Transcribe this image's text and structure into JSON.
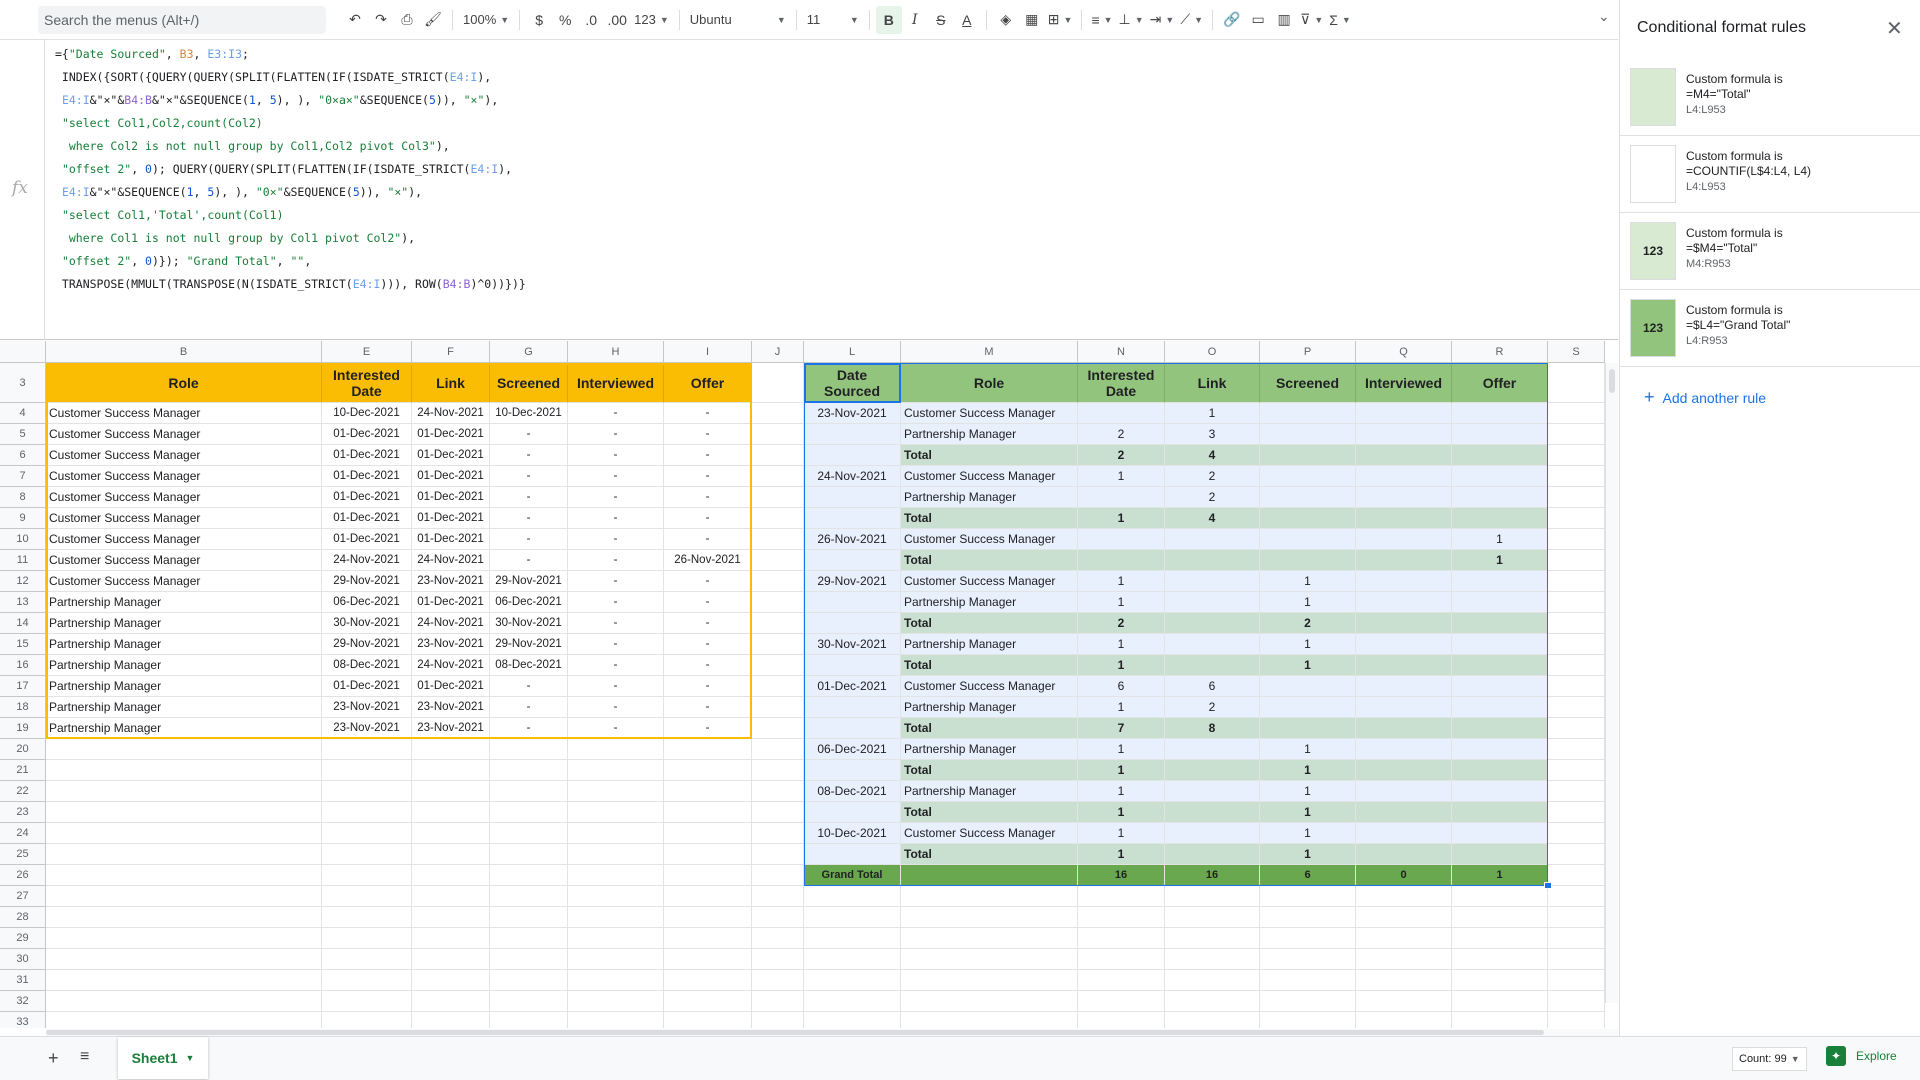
{
  "toolbar": {
    "search_placeholder": "Search the menus (Alt+/)",
    "zoom": "100%",
    "currency": "$",
    "percent": "%",
    "dec_less": ".0",
    "dec_more": ".00",
    "number_format": "123",
    "font": "Ubuntu",
    "font_size": "11",
    "bold": "B",
    "italic": "I",
    "strike": "S",
    "text_color": "A",
    "functions": "Σ"
  },
  "formula_bar": {
    "fx": "fx",
    "lines": [
      [
        [
          "={",
          "t"
        ],
        [
          "\"Date Sourced\"",
          "str"
        ],
        [
          ", ",
          "t"
        ],
        [
          "B3",
          "r1"
        ],
        [
          ", ",
          "t"
        ],
        [
          "E3:I3",
          "r2"
        ],
        [
          ";",
          "t"
        ]
      ],
      [
        [
          " INDEX({SORT({QUERY(QUERY(SPLIT(FLATTEN(IF(ISDATE_STRICT(",
          "t"
        ],
        [
          "E4:I",
          "r2"
        ],
        [
          "),",
          "t"
        ]
      ],
      [
        [
          " ",
          "t"
        ],
        [
          "E4:I",
          "r2"
        ],
        [
          "&\"×\"&",
          "t"
        ],
        [
          "B4:B",
          "r3"
        ],
        [
          "&\"×\"&SEQUENCE(",
          "t"
        ],
        [
          "1",
          "num"
        ],
        [
          ", ",
          "t"
        ],
        [
          "5",
          "num"
        ],
        [
          "), ), ",
          "t"
        ],
        [
          "\"0×a×\"",
          "str"
        ],
        [
          "&SEQUENCE(",
          "t"
        ],
        [
          "5",
          "num"
        ],
        [
          ")), ",
          "t"
        ],
        [
          "\"×\"",
          "str"
        ],
        [
          "),",
          "t"
        ]
      ],
      [
        [
          " ",
          "t"
        ],
        [
          "\"select Col1,Col2,count(Col2)",
          "str"
        ]
      ],
      [
        [
          "  ",
          "t"
        ],
        [
          "where Col2 is not null group by Col1,Col2 pivot Col3\"",
          "str"
        ],
        [
          "),",
          "t"
        ]
      ],
      [
        [
          " ",
          "t"
        ],
        [
          "\"offset 2\"",
          "str"
        ],
        [
          ", ",
          "t"
        ],
        [
          "0",
          "num"
        ],
        [
          "); QUERY(QUERY(SPLIT(FLATTEN(IF(ISDATE_STRICT(",
          "t"
        ],
        [
          "E4:I",
          "r2"
        ],
        [
          "),",
          "t"
        ]
      ],
      [
        [
          " ",
          "t"
        ],
        [
          "E4:I",
          "r2"
        ],
        [
          "&\"×\"&SEQUENCE(",
          "t"
        ],
        [
          "1",
          "num"
        ],
        [
          ", ",
          "t"
        ],
        [
          "5",
          "num"
        ],
        [
          "), ), ",
          "t"
        ],
        [
          "\"0×\"",
          "str"
        ],
        [
          "&SEQUENCE(",
          "t"
        ],
        [
          "5",
          "num"
        ],
        [
          ")), ",
          "t"
        ],
        [
          "\"×\"",
          "str"
        ],
        [
          "),",
          "t"
        ]
      ],
      [
        [
          " ",
          "t"
        ],
        [
          "\"select Col1,'Total',count(Col1)",
          "str"
        ]
      ],
      [
        [
          "  ",
          "t"
        ],
        [
          "where Col1 is not null group by Col1 pivot Col2\"",
          "str"
        ],
        [
          "),",
          "t"
        ]
      ],
      [
        [
          " ",
          "t"
        ],
        [
          "\"offset 2\"",
          "str"
        ],
        [
          ", ",
          "t"
        ],
        [
          "0",
          "num"
        ],
        [
          ")}); ",
          "t"
        ],
        [
          "\"Grand Total\"",
          "str"
        ],
        [
          ", ",
          "t"
        ],
        [
          "\"\"",
          "str"
        ],
        [
          ",",
          "t"
        ]
      ],
      [
        [
          " TRANSPOSE(MMULT(TRANSPOSE(N(ISDATE_STRICT(",
          "t"
        ],
        [
          "E4:I",
          "r2"
        ],
        [
          "))), ROW(",
          "t"
        ],
        [
          "B4:B",
          "r3"
        ],
        [
          ")^0))})}",
          "t"
        ]
      ]
    ]
  },
  "grid": {
    "col_headers": [
      "B",
      "E",
      "F",
      "G",
      "H",
      "I",
      "J",
      "L",
      "M",
      "N",
      "O",
      "P",
      "Q",
      "R",
      "S"
    ],
    "row_numbers": [
      "3",
      "4",
      "5",
      "6",
      "7",
      "8",
      "9",
      "10",
      "11",
      "12",
      "13",
      "14",
      "15",
      "16",
      "17",
      "18",
      "19",
      "20",
      "21",
      "22",
      "23",
      "24",
      "25",
      "26",
      "27",
      "28",
      "29",
      "30",
      "31",
      "32",
      "33"
    ],
    "left_table": {
      "headers": [
        "Role",
        "Interested Date",
        "Link",
        "Screened",
        "Interviewed",
        "Offer"
      ],
      "rows": [
        [
          "Customer Success Manager",
          "10-Dec-2021",
          "24-Nov-2021",
          "10-Dec-2021",
          "-",
          "-"
        ],
        [
          "Customer Success Manager",
          "01-Dec-2021",
          "01-Dec-2021",
          "-",
          "-",
          "-"
        ],
        [
          "Customer Success Manager",
          "01-Dec-2021",
          "01-Dec-2021",
          "-",
          "-",
          "-"
        ],
        [
          "Customer Success Manager",
          "01-Dec-2021",
          "01-Dec-2021",
          "-",
          "-",
          "-"
        ],
        [
          "Customer Success Manager",
          "01-Dec-2021",
          "01-Dec-2021",
          "-",
          "-",
          "-"
        ],
        [
          "Customer Success Manager",
          "01-Dec-2021",
          "01-Dec-2021",
          "-",
          "-",
          "-"
        ],
        [
          "Customer Success Manager",
          "01-Dec-2021",
          "01-Dec-2021",
          "-",
          "-",
          "-"
        ],
        [
          "Customer Success Manager",
          "24-Nov-2021",
          "24-Nov-2021",
          "-",
          "-",
          "26-Nov-2021"
        ],
        [
          "Customer Success Manager",
          "29-Nov-2021",
          "23-Nov-2021",
          "29-Nov-2021",
          "-",
          "-"
        ],
        [
          "Partnership Manager",
          "06-Dec-2021",
          "01-Dec-2021",
          "06-Dec-2021",
          "-",
          "-"
        ],
        [
          "Partnership Manager",
          "30-Nov-2021",
          "24-Nov-2021",
          "30-Nov-2021",
          "-",
          "-"
        ],
        [
          "Partnership Manager",
          "29-Nov-2021",
          "23-Nov-2021",
          "29-Nov-2021",
          "-",
          "-"
        ],
        [
          "Partnership Manager",
          "08-Dec-2021",
          "24-Nov-2021",
          "08-Dec-2021",
          "-",
          "-"
        ],
        [
          "Partnership Manager",
          "01-Dec-2021",
          "01-Dec-2021",
          "-",
          "-",
          "-"
        ],
        [
          "Partnership Manager",
          "23-Nov-2021",
          "23-Nov-2021",
          "-",
          "-",
          "-"
        ],
        [
          "Partnership Manager",
          "23-Nov-2021",
          "23-Nov-2021",
          "-",
          "-",
          "-"
        ]
      ]
    },
    "right_table": {
      "headers": [
        "Date Sourced",
        "Role",
        "Interested Date",
        "Link",
        "Screened",
        "Interviewed",
        "Offer"
      ],
      "rows": [
        [
          "23-Nov-2021",
          "Customer Success Manager",
          "",
          "1",
          "",
          "",
          ""
        ],
        [
          "",
          "Partnership Manager",
          "2",
          "3",
          "",
          "",
          ""
        ],
        [
          "",
          "Total",
          "2",
          "4",
          "",
          "",
          ""
        ],
        [
          "24-Nov-2021",
          "Customer Success Manager",
          "1",
          "2",
          "",
          "",
          ""
        ],
        [
          "",
          "Partnership Manager",
          "",
          "2",
          "",
          "",
          ""
        ],
        [
          "",
          "Total",
          "1",
          "4",
          "",
          "",
          ""
        ],
        [
          "26-Nov-2021",
          "Customer Success Manager",
          "",
          "",
          "",
          "",
          "1"
        ],
        [
          "",
          "Total",
          "",
          "",
          "",
          "",
          "1"
        ],
        [
          "29-Nov-2021",
          "Customer Success Manager",
          "1",
          "",
          "1",
          "",
          ""
        ],
        [
          "",
          "Partnership Manager",
          "1",
          "",
          "1",
          "",
          ""
        ],
        [
          "",
          "Total",
          "2",
          "",
          "2",
          "",
          ""
        ],
        [
          "30-Nov-2021",
          "Partnership Manager",
          "1",
          "",
          "1",
          "",
          ""
        ],
        [
          "",
          "Total",
          "1",
          "",
          "1",
          "",
          ""
        ],
        [
          "01-Dec-2021",
          "Customer Success Manager",
          "6",
          "6",
          "",
          "",
          ""
        ],
        [
          "",
          "Partnership Manager",
          "1",
          "2",
          "",
          "",
          ""
        ],
        [
          "",
          "Total",
          "7",
          "8",
          "",
          "",
          ""
        ],
        [
          "06-Dec-2021",
          "Partnership Manager",
          "1",
          "",
          "1",
          "",
          ""
        ],
        [
          "",
          "Total",
          "1",
          "",
          "1",
          "",
          ""
        ],
        [
          "08-Dec-2021",
          "Partnership Manager",
          "1",
          "",
          "1",
          "",
          ""
        ],
        [
          "",
          "Total",
          "1",
          "",
          "1",
          "",
          ""
        ],
        [
          "10-Dec-2021",
          "Customer Success Manager",
          "1",
          "",
          "1",
          "",
          ""
        ],
        [
          "",
          "Total",
          "1",
          "",
          "1",
          "",
          ""
        ],
        [
          "Grand Total",
          "",
          "16",
          "16",
          "6",
          "0",
          "1"
        ]
      ]
    }
  },
  "panel": {
    "title": "Conditional format rules",
    "rules": [
      {
        "type": "Custom formula is",
        "formula": "=M4=\"Total\"",
        "range": "L4:L953",
        "swatch": "",
        "color": "#d9ead3"
      },
      {
        "type": "Custom formula is",
        "formula": "=COUNTIF(L$4:L4, L4)",
        "range": "L4:L953",
        "swatch": "",
        "color": "#ffffff"
      },
      {
        "type": "Custom formula is",
        "formula": "=$M4=\"Total\"",
        "range": "M4:R953",
        "swatch": "123",
        "color": "#d9ead3"
      },
      {
        "type": "Custom formula is",
        "formula": "=$L4=\"Grand Total\"",
        "range": "L4:R953",
        "swatch": "123",
        "color": "#93c47d"
      }
    ],
    "add_rule": "Add another rule"
  },
  "bottom": {
    "sheet_name": "Sheet1",
    "count": "Count: 99",
    "explore": "Explore"
  },
  "colors": {
    "left_header": "#fbbc04",
    "right_header": "#93c47d",
    "total_row": "#c9dfd0",
    "data_row": "#e8f0fe",
    "grand_total": "#6aa84f",
    "selection": "#1a73e8"
  }
}
